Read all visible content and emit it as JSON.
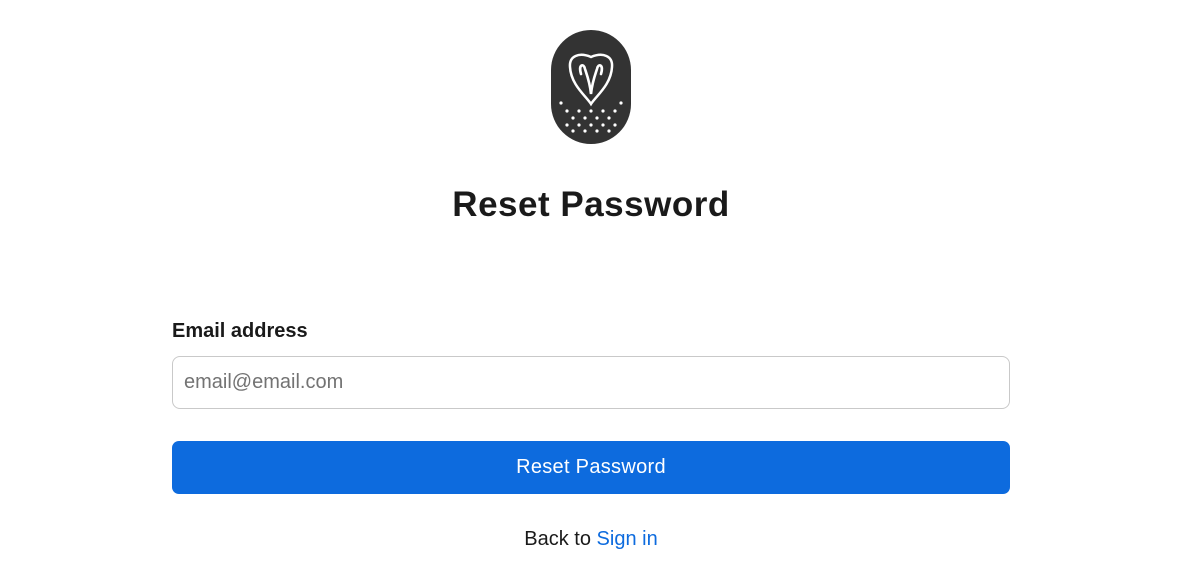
{
  "logo": {
    "icon": "owl-logo-icon",
    "color": "#333333"
  },
  "header": {
    "title": "Reset Password"
  },
  "form": {
    "email_label": "Email address",
    "email_value": "",
    "email_placeholder": "email@email.com",
    "submit_label": "Reset Password"
  },
  "footer": {
    "prefix": "Back to",
    "signin_link": "Sign in"
  },
  "colors": {
    "accent": "#0d6bde",
    "text": "#1a1a1a",
    "border": "#c9c9c9"
  }
}
